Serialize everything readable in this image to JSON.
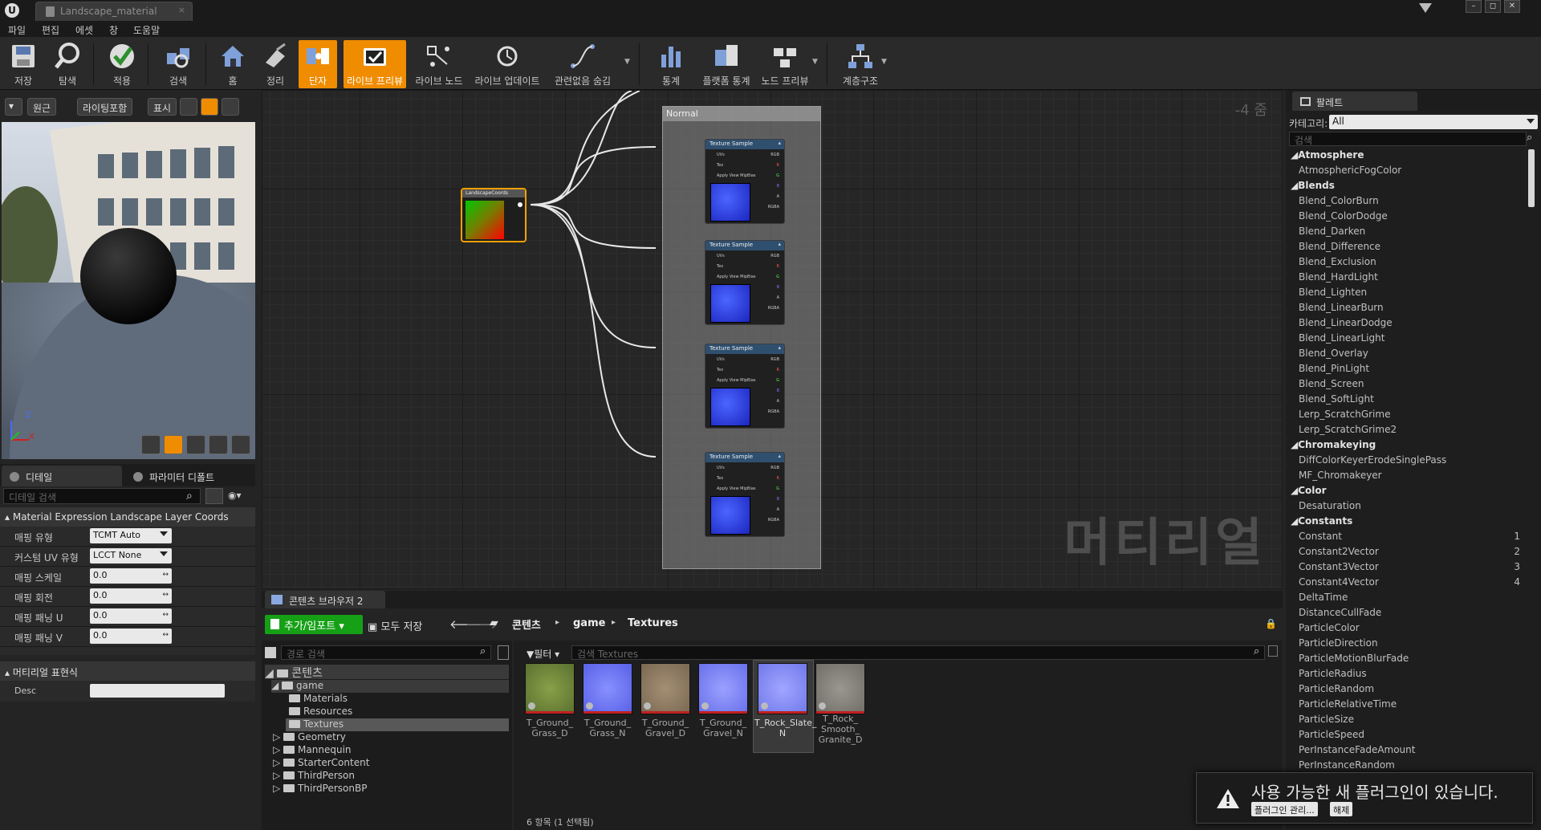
{
  "window": {
    "tab_title": "Landscape_material",
    "tab_close": "×",
    "controls": [
      "–",
      "◻",
      "✕"
    ]
  },
  "menu": [
    "파일",
    "편집",
    "에셋",
    "창",
    "도움말"
  ],
  "toolbar": [
    {
      "label": "저장",
      "icon": "save-icon",
      "active": false
    },
    {
      "label": "탐색",
      "icon": "browse-icon",
      "active": false
    },
    {
      "label": "적용",
      "icon": "apply-icon",
      "active": false
    },
    {
      "label": "검색",
      "icon": "search-icon",
      "active": false
    },
    {
      "label": "홈",
      "icon": "home-icon",
      "active": false
    },
    {
      "label": "정리",
      "icon": "clean-up-icon",
      "active": false
    },
    {
      "label": "단자",
      "icon": "connectors-icon",
      "active": true
    },
    {
      "label": "라이브 프리뷰",
      "icon": "live-preview-icon",
      "active": true
    },
    {
      "label": "라이브 노드",
      "icon": "live-nodes-icon",
      "active": false
    },
    {
      "label": "라이브 업데이트",
      "icon": "live-update-icon",
      "active": false
    },
    {
      "label": "관련없음 숨김",
      "icon": "hide-unrelated-icon",
      "active": false
    },
    {
      "label": "통계",
      "icon": "stats-icon",
      "active": false
    },
    {
      "label": "플랫폼 통계",
      "icon": "platform-stats-icon",
      "active": false
    },
    {
      "label": "노드 프리뷰",
      "icon": "node-preview-icon",
      "active": false
    },
    {
      "label": "계층구조",
      "icon": "hierarchy-icon",
      "active": false
    }
  ],
  "viewport": {
    "btn_perspective": "원근",
    "btn_lit": "라이팅포함",
    "btn_show": "표시",
    "axis_x": "X",
    "axis_z": "Z"
  },
  "details": {
    "tab_details": "디테일",
    "tab_params": "파라미터 디폴트",
    "search_placeholder": "디테일 검색",
    "section1": "Material Expression Landscape Layer Coords",
    "rows": [
      {
        "label": "매핑 유형",
        "value": "TCMT Auto",
        "kind": "combo"
      },
      {
        "label": "커스텀 UV 유형",
        "value": "LCCT None",
        "kind": "combo"
      },
      {
        "label": "매핑 스케일",
        "value": "0.0",
        "kind": "num"
      },
      {
        "label": "매핑 회전",
        "value": "0.0",
        "kind": "num"
      },
      {
        "label": "매핑 패닝 U",
        "value": "0.0",
        "kind": "num"
      },
      {
        "label": "매핑 패닝 V",
        "value": "0.0",
        "kind": "num"
      }
    ],
    "section2": "머티리얼 표현식",
    "desc_label": "Desc",
    "desc_value": ""
  },
  "graph": {
    "zoom": "-4 줌",
    "watermark": "머티리얼",
    "comment_title": "Normal",
    "landscape_node_title": "LandscapeCoords",
    "texture_node_title": "Texture Sample",
    "texture_pins_left": [
      "UVs",
      "Tex",
      "Apply View MipBias"
    ],
    "texture_pins_right": [
      "RGB",
      "R",
      "G",
      "B",
      "A",
      "RGBA"
    ]
  },
  "content_browser": {
    "tab": "콘텐츠 브라우저 2",
    "add_import": "추가/임포트",
    "save_all": "모두 저장",
    "path": [
      "콘텐츠",
      "game",
      "Textures"
    ],
    "path_search_placeholder": "경로 검색",
    "filter": "필터",
    "search_placeholder": "검색 Textures",
    "tree": [
      {
        "label": "콘텐츠",
        "level": 0
      },
      {
        "label": "game",
        "level": 1
      },
      {
        "label": "Materials",
        "level": 2
      },
      {
        "label": "Resources",
        "level": 2
      },
      {
        "label": "Textures",
        "level": 2
      },
      {
        "label": "Geometry",
        "level": 1
      },
      {
        "label": "Mannequin",
        "level": 1
      },
      {
        "label": "StarterContent",
        "level": 1
      },
      {
        "label": "ThirdPerson",
        "level": 1
      },
      {
        "label": "ThirdPersonBP",
        "level": 1
      }
    ],
    "assets": [
      {
        "label": "T_Ground_ Grass_D",
        "color": "#6f8a3a"
      },
      {
        "label": "T_Ground_ Grass_N",
        "color": "#6f74f0"
      },
      {
        "label": "T_Ground_ Gravel_D",
        "color": "#8d7a62"
      },
      {
        "label": "T_Ground_ Gravel_N",
        "color": "#7a7ff2"
      },
      {
        "label": "T_Rock_Slate_ N",
        "color": "#8a90ef"
      },
      {
        "label": "T_Rock_ Smooth_ Granite_D",
        "color": "#8a8782"
      }
    ],
    "status": "6 항목 (1 선택됨)"
  },
  "palette": {
    "tab": "팔레트",
    "category_label": "카테고리:",
    "category_value": "All",
    "search_placeholder": "검색",
    "rows": [
      {
        "t": "cat",
        "label": "Atmosphere"
      },
      {
        "t": "item",
        "label": "AtmosphericFogColor"
      },
      {
        "t": "cat",
        "label": "Blends"
      },
      {
        "t": "item",
        "label": "Blend_ColorBurn"
      },
      {
        "t": "item",
        "label": "Blend_ColorDodge"
      },
      {
        "t": "item",
        "label": "Blend_Darken"
      },
      {
        "t": "item",
        "label": "Blend_Difference"
      },
      {
        "t": "item",
        "label": "Blend_Exclusion"
      },
      {
        "t": "item",
        "label": "Blend_HardLight"
      },
      {
        "t": "item",
        "label": "Blend_Lighten"
      },
      {
        "t": "item",
        "label": "Blend_LinearBurn"
      },
      {
        "t": "item",
        "label": "Blend_LinearDodge"
      },
      {
        "t": "item",
        "label": "Blend_LinearLight"
      },
      {
        "t": "item",
        "label": "Blend_Overlay"
      },
      {
        "t": "item",
        "label": "Blend_PinLight"
      },
      {
        "t": "item",
        "label": "Blend_Screen"
      },
      {
        "t": "item",
        "label": "Blend_SoftLight"
      },
      {
        "t": "item",
        "label": "Lerp_ScratchGrime"
      },
      {
        "t": "item",
        "label": "Lerp_ScratchGrime2"
      },
      {
        "t": "cat",
        "label": "Chromakeying"
      },
      {
        "t": "item",
        "label": "DiffColorKeyerErodeSinglePass"
      },
      {
        "t": "item",
        "label": "MF_Chromakeyer"
      },
      {
        "t": "cat",
        "label": "Color"
      },
      {
        "t": "item",
        "label": "Desaturation"
      },
      {
        "t": "cat",
        "label": "Constants"
      },
      {
        "t": "item",
        "label": "Constant",
        "num": "1"
      },
      {
        "t": "item",
        "label": "Constant2Vector",
        "num": "2"
      },
      {
        "t": "item",
        "label": "Constant3Vector",
        "num": "3"
      },
      {
        "t": "item",
        "label": "Constant4Vector",
        "num": "4"
      },
      {
        "t": "item",
        "label": "DeltaTime"
      },
      {
        "t": "item",
        "label": "DistanceCullFade"
      },
      {
        "t": "item",
        "label": "ParticleColor"
      },
      {
        "t": "item",
        "label": "ParticleDirection"
      },
      {
        "t": "item",
        "label": "ParticleMotionBlurFade"
      },
      {
        "t": "item",
        "label": "ParticleRadius"
      },
      {
        "t": "item",
        "label": "ParticleRandom"
      },
      {
        "t": "item",
        "label": "ParticleRelativeTime"
      },
      {
        "t": "item",
        "label": "ParticleSize"
      },
      {
        "t": "item",
        "label": "ParticleSpeed"
      },
      {
        "t": "item",
        "label": "PerInstanceFadeAmount"
      },
      {
        "t": "item",
        "label": "PerInstanceRandom"
      }
    ]
  },
  "toast": {
    "message": "사용 가능한 새 플러그인이 있습니다.",
    "manage": "플러그인 관리...",
    "dismiss": "해제"
  }
}
